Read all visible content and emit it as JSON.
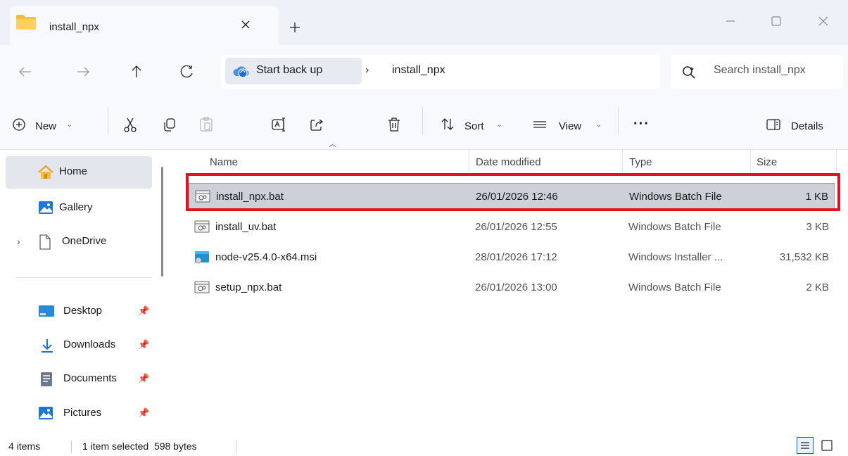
{
  "tab": {
    "title": "install_npx"
  },
  "address": {
    "root_label": "Start back up",
    "separator": "›",
    "current": "install_npx",
    "search_placeholder": "Search install_npx"
  },
  "commands": {
    "new_label": "New",
    "sort_label": "Sort",
    "view_label": "View",
    "more_label": "···",
    "details_label": "Details"
  },
  "sidebar": {
    "items": [
      {
        "label": "Home"
      },
      {
        "label": "Gallery"
      },
      {
        "label": "OneDrive"
      },
      {
        "label": "Desktop"
      },
      {
        "label": "Downloads"
      },
      {
        "label": "Documents"
      },
      {
        "label": "Pictures"
      }
    ]
  },
  "columns": {
    "name": "Name",
    "date": "Date modified",
    "type": "Type",
    "size": "Size"
  },
  "files": [
    {
      "name": "install_npx.bat",
      "date": "26/01/2026 12:46",
      "type": "Windows Batch File",
      "size": "1 KB",
      "icon": "batch-file-icon",
      "selected": true
    },
    {
      "name": "install_uv.bat",
      "date": "26/01/2026 12:55",
      "type": "Windows Batch File",
      "size": "3 KB",
      "icon": "batch-file-icon",
      "selected": false
    },
    {
      "name": "node-v25.4.0-x64.msi",
      "date": "28/01/2026 17:12",
      "type": "Windows Installer ...",
      "size": "31,532 KB",
      "icon": "installer-icon",
      "selected": false
    },
    {
      "name": "setup_npx.bat",
      "date": "26/01/2026 13:00",
      "type": "Windows Batch File",
      "size": "2 KB",
      "icon": "batch-file-icon",
      "selected": false
    }
  ],
  "status": {
    "count": "4 items",
    "selection": "1 item selected  598 bytes"
  },
  "colors": {
    "highlight": "#e0141e",
    "accent": "#0a64c2",
    "selected_row": "#cdd0d6"
  }
}
